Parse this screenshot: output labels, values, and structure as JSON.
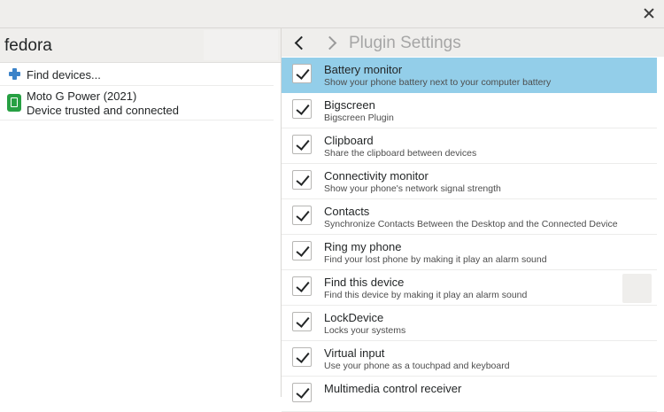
{
  "sidebar": {
    "host_name": "fedora",
    "find_devices_label": "Find devices...",
    "device": {
      "name": "Moto G Power (2021)",
      "status": "Device trusted and connected"
    }
  },
  "main": {
    "title": "Plugin Settings",
    "plugins": [
      {
        "name": "Battery monitor",
        "desc": "Show your phone battery next to your computer battery",
        "checked": true
      },
      {
        "name": "Bigscreen",
        "desc": "Bigscreen Plugin",
        "checked": true
      },
      {
        "name": "Clipboard",
        "desc": "Share the clipboard between devices",
        "checked": true
      },
      {
        "name": "Connectivity monitor",
        "desc": "Show your phone's network signal strength",
        "checked": true
      },
      {
        "name": "Contacts",
        "desc": "Synchronize Contacts Between the Desktop and the Connected Device",
        "checked": true
      },
      {
        "name": "Ring my phone",
        "desc": "Find your lost phone by making it play an alarm sound",
        "checked": true
      },
      {
        "name": "Find this device",
        "desc": "Find this device by making it play an alarm sound",
        "checked": true
      },
      {
        "name": "LockDevice",
        "desc": "Locks your systems",
        "checked": true
      },
      {
        "name": "Virtual input",
        "desc": "Use your phone as a touchpad and keyboard",
        "checked": true
      },
      {
        "name": "Multimedia control receiver",
        "desc": "",
        "checked": true
      }
    ]
  },
  "colors": {
    "selection": "#93cee9",
    "header_bg": "#efeeec",
    "accent_plus": "#3b83c9",
    "phone_icon": "#27a043"
  }
}
